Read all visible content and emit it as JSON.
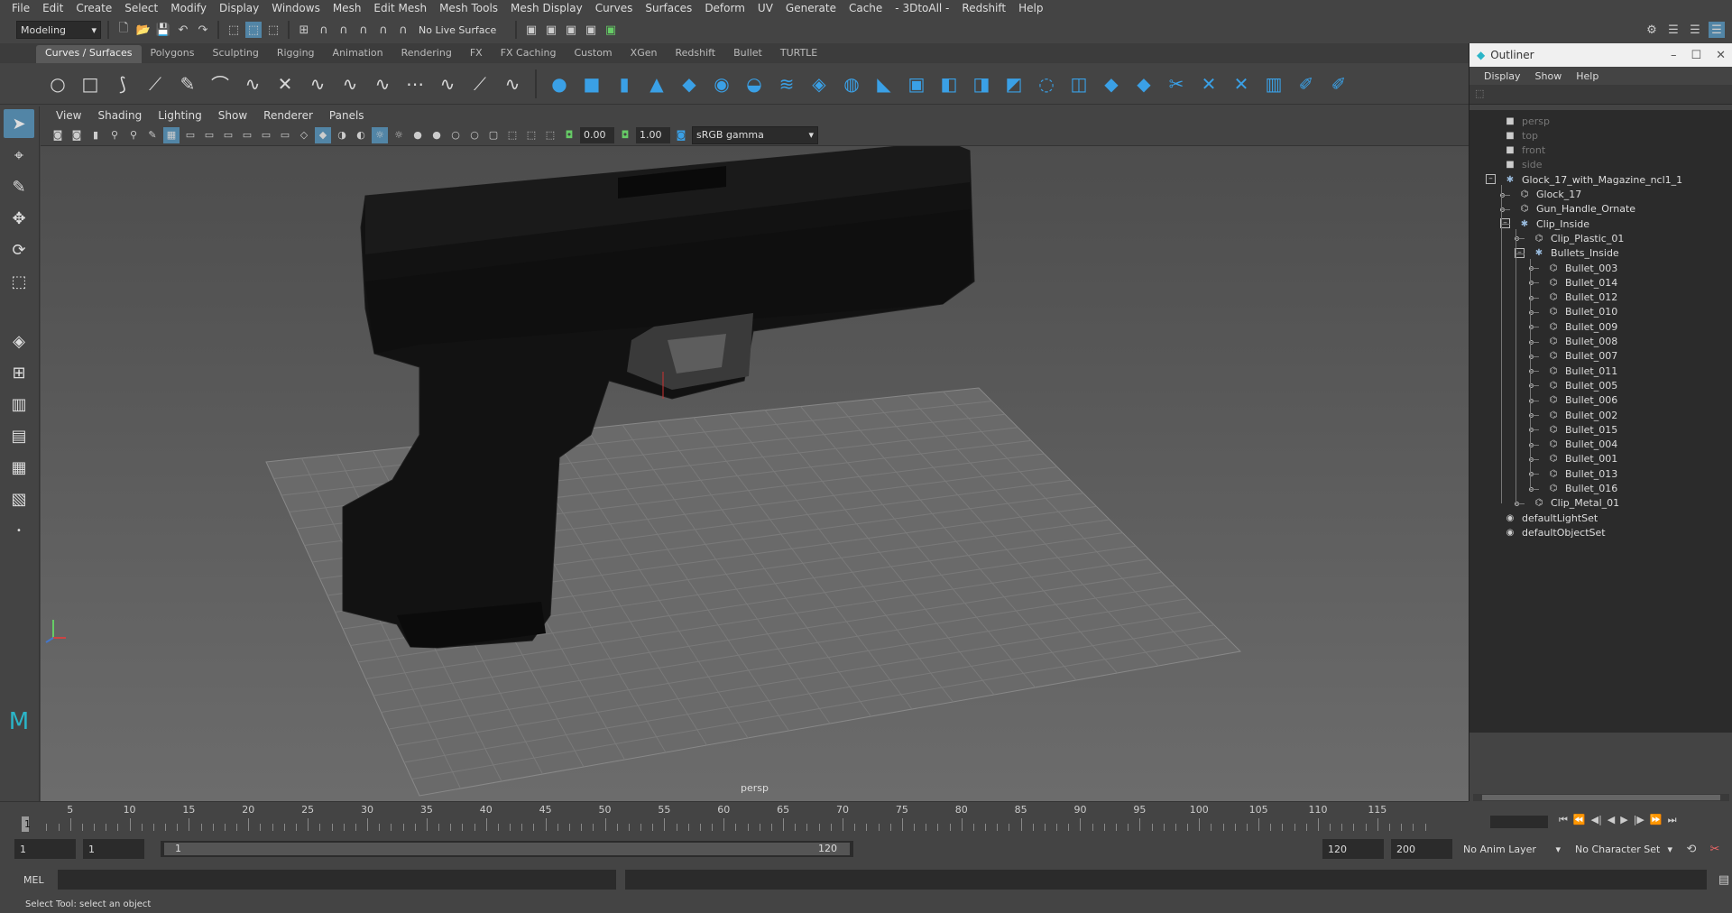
{
  "menubar": [
    "File",
    "Edit",
    "Create",
    "Select",
    "Modify",
    "Display",
    "Windows",
    "Mesh",
    "Edit Mesh",
    "Mesh Tools",
    "Mesh Display",
    "Curves",
    "Surfaces",
    "Deform",
    "UV",
    "Generate",
    "Cache",
    "- 3DtoAll -",
    "Redshift",
    "Help"
  ],
  "status": {
    "workspace": "Modeling",
    "live_surface": "No Live Surface"
  },
  "shelf_tabs": [
    "Curves / Surfaces",
    "Polygons",
    "Sculpting",
    "Rigging",
    "Animation",
    "Rendering",
    "FX",
    "FX Caching",
    "Custom",
    "XGen",
    "Redshift",
    "Bullet",
    "TURTLE"
  ],
  "panel_menu": [
    "View",
    "Shading",
    "Lighting",
    "Show",
    "Renderer",
    "Panels"
  ],
  "panel_bar": {
    "exposure": "0.00",
    "gamma": "1.00",
    "color_space": "sRGB gamma"
  },
  "viewport": {
    "camera_label": "persp"
  },
  "outliner": {
    "title": "Outliner",
    "menu": [
      "Display",
      "Show",
      "Help"
    ],
    "items": [
      {
        "label": "persp"
      },
      {
        "label": "top"
      },
      {
        "label": "front"
      },
      {
        "label": "side"
      },
      {
        "label": "Glock_17_with_Magazine_ncl1_1"
      },
      {
        "label": "Glock_17"
      },
      {
        "label": "Gun_Handle_Ornate"
      },
      {
        "label": "Clip_Inside"
      },
      {
        "label": "Clip_Plastic_01"
      },
      {
        "label": "Bullets_Inside"
      },
      {
        "label": "Bullet_003"
      },
      {
        "label": "Bullet_014"
      },
      {
        "label": "Bullet_012"
      },
      {
        "label": "Bullet_010"
      },
      {
        "label": "Bullet_009"
      },
      {
        "label": "Bullet_008"
      },
      {
        "label": "Bullet_007"
      },
      {
        "label": "Bullet_011"
      },
      {
        "label": "Bullet_005"
      },
      {
        "label": "Bullet_006"
      },
      {
        "label": "Bullet_002"
      },
      {
        "label": "Bullet_015"
      },
      {
        "label": "Bullet_004"
      },
      {
        "label": "Bullet_001"
      },
      {
        "label": "Bullet_013"
      },
      {
        "label": "Bullet_016"
      },
      {
        "label": "Clip_Metal_01"
      },
      {
        "label": "defaultLightSet"
      },
      {
        "label": "defaultObjectSet"
      }
    ]
  },
  "timeline": {
    "current_frame": "1",
    "ticks": [
      "5",
      "10",
      "15",
      "20",
      "25",
      "30",
      "35",
      "40",
      "45",
      "50",
      "55",
      "60",
      "65",
      "70",
      "75",
      "80",
      "85",
      "90",
      "95",
      "100",
      "105",
      "110",
      "115"
    ]
  },
  "range": {
    "start": "1",
    "playback_start": "1",
    "range_start": "1",
    "range_end": "120",
    "end": "120",
    "total_end": "200",
    "anim_layer": "No Anim Layer",
    "char_set": "No Character Set"
  },
  "command": {
    "lang": "MEL"
  },
  "help_line": "Select Tool: select an object"
}
